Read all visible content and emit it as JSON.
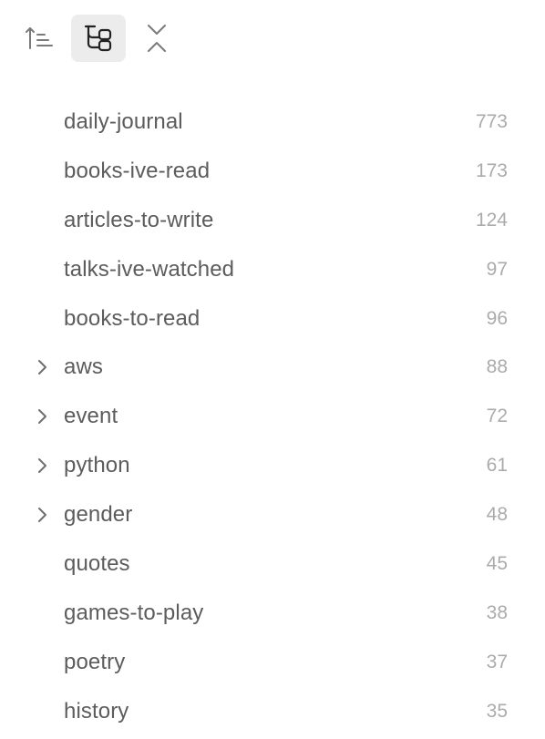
{
  "toolbar": {
    "buttons": [
      {
        "icon": "sort-ascending-icon",
        "active": false
      },
      {
        "icon": "nested-tags-icon",
        "active": true
      },
      {
        "icon": "collapse-all-icon",
        "active": false
      }
    ]
  },
  "tags": [
    {
      "name": "daily-journal",
      "count": "773",
      "expandable": false
    },
    {
      "name": "books-ive-read",
      "count": "173",
      "expandable": false
    },
    {
      "name": "articles-to-write",
      "count": "124",
      "expandable": false
    },
    {
      "name": "talks-ive-watched",
      "count": "97",
      "expandable": false
    },
    {
      "name": "books-to-read",
      "count": "96",
      "expandable": false
    },
    {
      "name": "aws",
      "count": "88",
      "expandable": true
    },
    {
      "name": "event",
      "count": "72",
      "expandable": true
    },
    {
      "name": "python",
      "count": "61",
      "expandable": true
    },
    {
      "name": "gender",
      "count": "48",
      "expandable": true
    },
    {
      "name": "quotes",
      "count": "45",
      "expandable": false
    },
    {
      "name": "games-to-play",
      "count": "38",
      "expandable": false
    },
    {
      "name": "poetry",
      "count": "37",
      "expandable": false
    },
    {
      "name": "history",
      "count": "35",
      "expandable": false
    }
  ]
}
